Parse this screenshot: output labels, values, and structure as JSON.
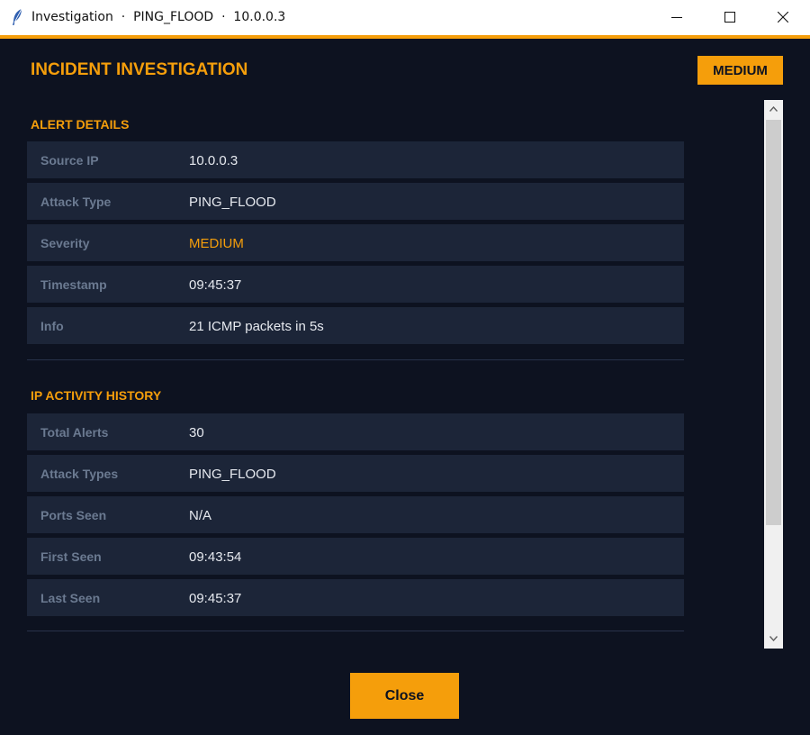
{
  "window": {
    "title": "Investigation  ·  PING_FLOOD  ·  10.0.0.3"
  },
  "header": {
    "title": "INCIDENT INVESTIGATION",
    "severity_badge": "MEDIUM"
  },
  "alert_details": {
    "title": "ALERT DETAILS",
    "rows": [
      {
        "label": "Source IP",
        "value": "10.0.0.3"
      },
      {
        "label": "Attack Type",
        "value": "PING_FLOOD"
      },
      {
        "label": "Severity",
        "value": "MEDIUM"
      },
      {
        "label": "Timestamp",
        "value": "09:45:37"
      },
      {
        "label": "Info",
        "value": "21 ICMP packets in 5s"
      }
    ]
  },
  "ip_activity": {
    "title": "IP ACTIVITY HISTORY",
    "rows": [
      {
        "label": "Total Alerts",
        "value": "30"
      },
      {
        "label": "Attack Types",
        "value": "PING_FLOOD"
      },
      {
        "label": "Ports Seen",
        "value": "N/A"
      },
      {
        "label": "First Seen",
        "value": "09:43:54"
      },
      {
        "label": "Last Seen",
        "value": "09:45:37"
      }
    ]
  },
  "footer": {
    "close_label": "Close"
  },
  "colors": {
    "accent": "#f59e0b",
    "background": "#0d1220",
    "row_background": "#1c2538",
    "label_text": "#6b7a91",
    "value_text": "#e6e9ef"
  },
  "icons": {
    "app": "feather-icon",
    "minimize": "minimize-icon",
    "maximize": "maximize-icon",
    "close": "close-icon"
  }
}
